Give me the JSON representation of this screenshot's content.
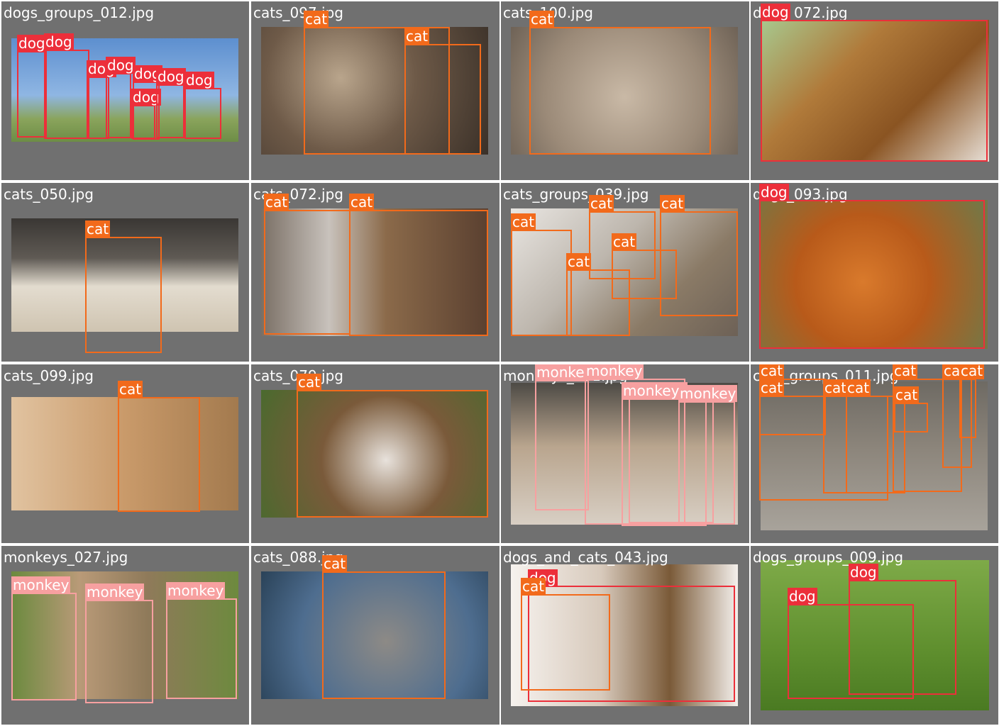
{
  "grid": {
    "cols": 4,
    "rows": 4,
    "tiles": [
      {
        "name": "dogs_groups_012.jpg",
        "boxes": [
          {
            "label": "dog",
            "cls": "dog"
          },
          {
            "label": "dog",
            "cls": "dog"
          },
          {
            "label": "dog",
            "cls": "dog"
          },
          {
            "label": "dog",
            "cls": "dog"
          },
          {
            "label": "dog",
            "cls": "dog"
          },
          {
            "label": "dog",
            "cls": "dog"
          },
          {
            "label": "dog",
            "cls": "dog"
          },
          {
            "label": "dog",
            "cls": "dog"
          }
        ]
      },
      {
        "name": "cats_097.jpg",
        "boxes": [
          {
            "label": "cat",
            "cls": "cat"
          },
          {
            "label": "cat",
            "cls": "cat"
          }
        ]
      },
      {
        "name": "cats_100.jpg",
        "boxes": [
          {
            "label": "cat",
            "cls": "cat"
          }
        ]
      },
      {
        "name": "dogs_072.jpg",
        "boxes": [
          {
            "label": "dog",
            "cls": "dog"
          }
        ]
      },
      {
        "name": "cats_050.jpg",
        "boxes": [
          {
            "label": "cat",
            "cls": "cat"
          }
        ]
      },
      {
        "name": "cats_072.jpg",
        "boxes": [
          {
            "label": "cat",
            "cls": "cat"
          },
          {
            "label": "cat",
            "cls": "cat"
          }
        ]
      },
      {
        "name": "cats_groups_039.jpg",
        "boxes": [
          {
            "label": "cat",
            "cls": "cat"
          },
          {
            "label": "cat",
            "cls": "cat"
          },
          {
            "label": "cat",
            "cls": "cat"
          },
          {
            "label": "cat",
            "cls": "cat"
          },
          {
            "label": "cat",
            "cls": "cat"
          }
        ]
      },
      {
        "name": "dogs_093.jpg",
        "boxes": [
          {
            "label": "dog",
            "cls": "dog"
          }
        ]
      },
      {
        "name": "cats_099.jpg",
        "boxes": [
          {
            "label": "cat",
            "cls": "cat"
          }
        ]
      },
      {
        "name": "cats_079.jpg",
        "boxes": [
          {
            "label": "cat",
            "cls": "cat"
          }
        ]
      },
      {
        "name": "monkeys_061.jpg",
        "boxes": [
          {
            "label": "monkey",
            "cls": "monkey"
          },
          {
            "label": "monkey",
            "cls": "monkey"
          },
          {
            "label": "monkey",
            "cls": "monkey"
          },
          {
            "label": "monkey",
            "cls": "monkey"
          },
          {
            "label": "monkey",
            "cls": "monkey"
          }
        ]
      },
      {
        "name": "cats_groups_011.jpg",
        "boxes": [
          {
            "label": "cat",
            "cls": "cat"
          },
          {
            "label": "cat",
            "cls": "cat"
          },
          {
            "label": "cat",
            "cls": "cat"
          },
          {
            "label": "cat",
            "cls": "cat"
          },
          {
            "label": "cat",
            "cls": "cat"
          },
          {
            "label": "cat",
            "cls": "cat"
          },
          {
            "label": "cat",
            "cls": "cat"
          },
          {
            "label": "cat",
            "cls": "cat"
          }
        ]
      },
      {
        "name": "monkeys_027.jpg",
        "boxes": [
          {
            "label": "monkey",
            "cls": "monkey"
          },
          {
            "label": "monkey",
            "cls": "monkey"
          },
          {
            "label": "monkey",
            "cls": "monkey"
          }
        ]
      },
      {
        "name": "cats_088.jpg",
        "boxes": [
          {
            "label": "cat",
            "cls": "cat"
          }
        ]
      },
      {
        "name": "dogs_and_cats_043.jpg",
        "boxes": [
          {
            "label": "dog",
            "cls": "dog"
          },
          {
            "label": "cat",
            "cls": "cat"
          }
        ]
      },
      {
        "name": "dogs_groups_009.jpg",
        "boxes": [
          {
            "label": "dog",
            "cls": "dog"
          },
          {
            "label": "dog",
            "cls": "dog"
          }
        ]
      }
    ]
  },
  "colors": {
    "cat": "#f26a1b",
    "dog": "#ec2f3a",
    "monkey": "#f7a0a0",
    "tile_bg": "#707070"
  }
}
